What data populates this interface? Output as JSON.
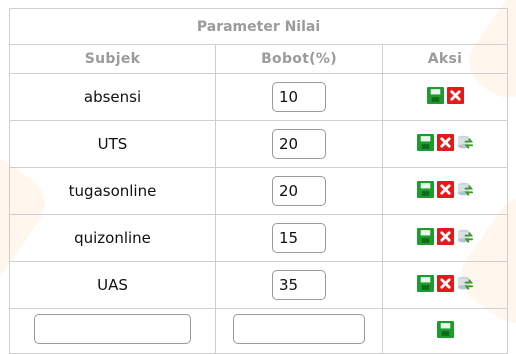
{
  "table": {
    "title": "Parameter Nilai",
    "columns": [
      "Subjek",
      "Bobot(%)",
      "Aksi"
    ],
    "rows": [
      {
        "subject": "absensi",
        "weight": "10",
        "actions": [
          "save-icon",
          "delete-icon"
        ]
      },
      {
        "subject": "UTS",
        "weight": "20",
        "actions": [
          "save-icon",
          "delete-icon",
          "refresh-icon"
        ]
      },
      {
        "subject": "tugasonline",
        "weight": "20",
        "actions": [
          "save-icon",
          "delete-icon",
          "refresh-icon"
        ]
      },
      {
        "subject": "quizonline",
        "weight": "15",
        "actions": [
          "save-icon",
          "delete-icon",
          "refresh-icon"
        ]
      },
      {
        "subject": "UAS",
        "weight": "35",
        "actions": [
          "save-icon",
          "delete-icon",
          "refresh-icon"
        ]
      }
    ],
    "new_row": {
      "subject_value": "",
      "weight_value": "",
      "actions": [
        "save-icon"
      ]
    }
  },
  "colors": {
    "header_text": "#9b9b9b",
    "border": "#cfcfcf",
    "save": "#1e9b2e",
    "delete": "#e01b1b"
  }
}
